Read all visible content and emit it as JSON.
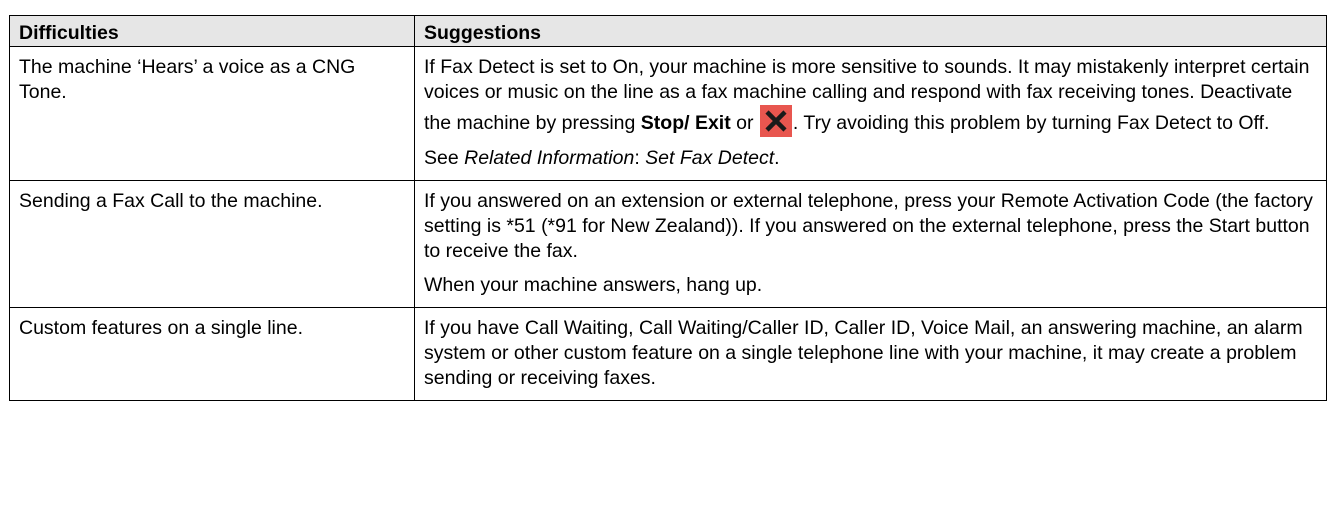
{
  "table": {
    "headers": [
      "Difficulties",
      "Suggestions"
    ],
    "rows": [
      {
        "difficulty": "The machine ‘Hears’ a voice as a CNG Tone.",
        "s1_text": "If Fax Detect is set to On, your machine is more sensitive to sounds. It may mistakenly interpret certain voices or music on the line as a fax machine calling and respond with fax receiving tones. Deactivate the machine by pressing ",
        "s1_bold1": "Stop/ Exit",
        "s1_or": " or ",
        "s1_tail": ". Try avoiding this problem by turning Fax Detect to Off.",
        "s2_pre": "See ",
        "s2_italic1": "Related Information",
        "s2_colon": ": ",
        "s2_italic2": "Set Fax Detect",
        "s2_end": "."
      },
      {
        "difficulty": "Sending a Fax Call to the machine.",
        "s1": "If you answered on an extension or external telephone, press your Remote Activation Code (the factory setting is *51 (*91 for New Zealand)). If you answered on the external telephone, press the Start button to receive the fax.",
        "s2": "When your machine answers, hang up."
      },
      {
        "difficulty": "Custom features on a single line.",
        "s1": "If you have Call Waiting, Call Waiting/Caller ID, Caller ID, Voice Mail, an answering machine, an alarm system or other custom feature on a single telephone line with your machine, it may create a problem sending or receiving faxes."
      }
    ]
  },
  "icons": {
    "stop_exit": "cross-icon"
  },
  "colors": {
    "header_bg": "#e6e6e6",
    "border": "#000000",
    "cross_bg": "#e8564f",
    "cross_fg": "#1a1a1a"
  }
}
